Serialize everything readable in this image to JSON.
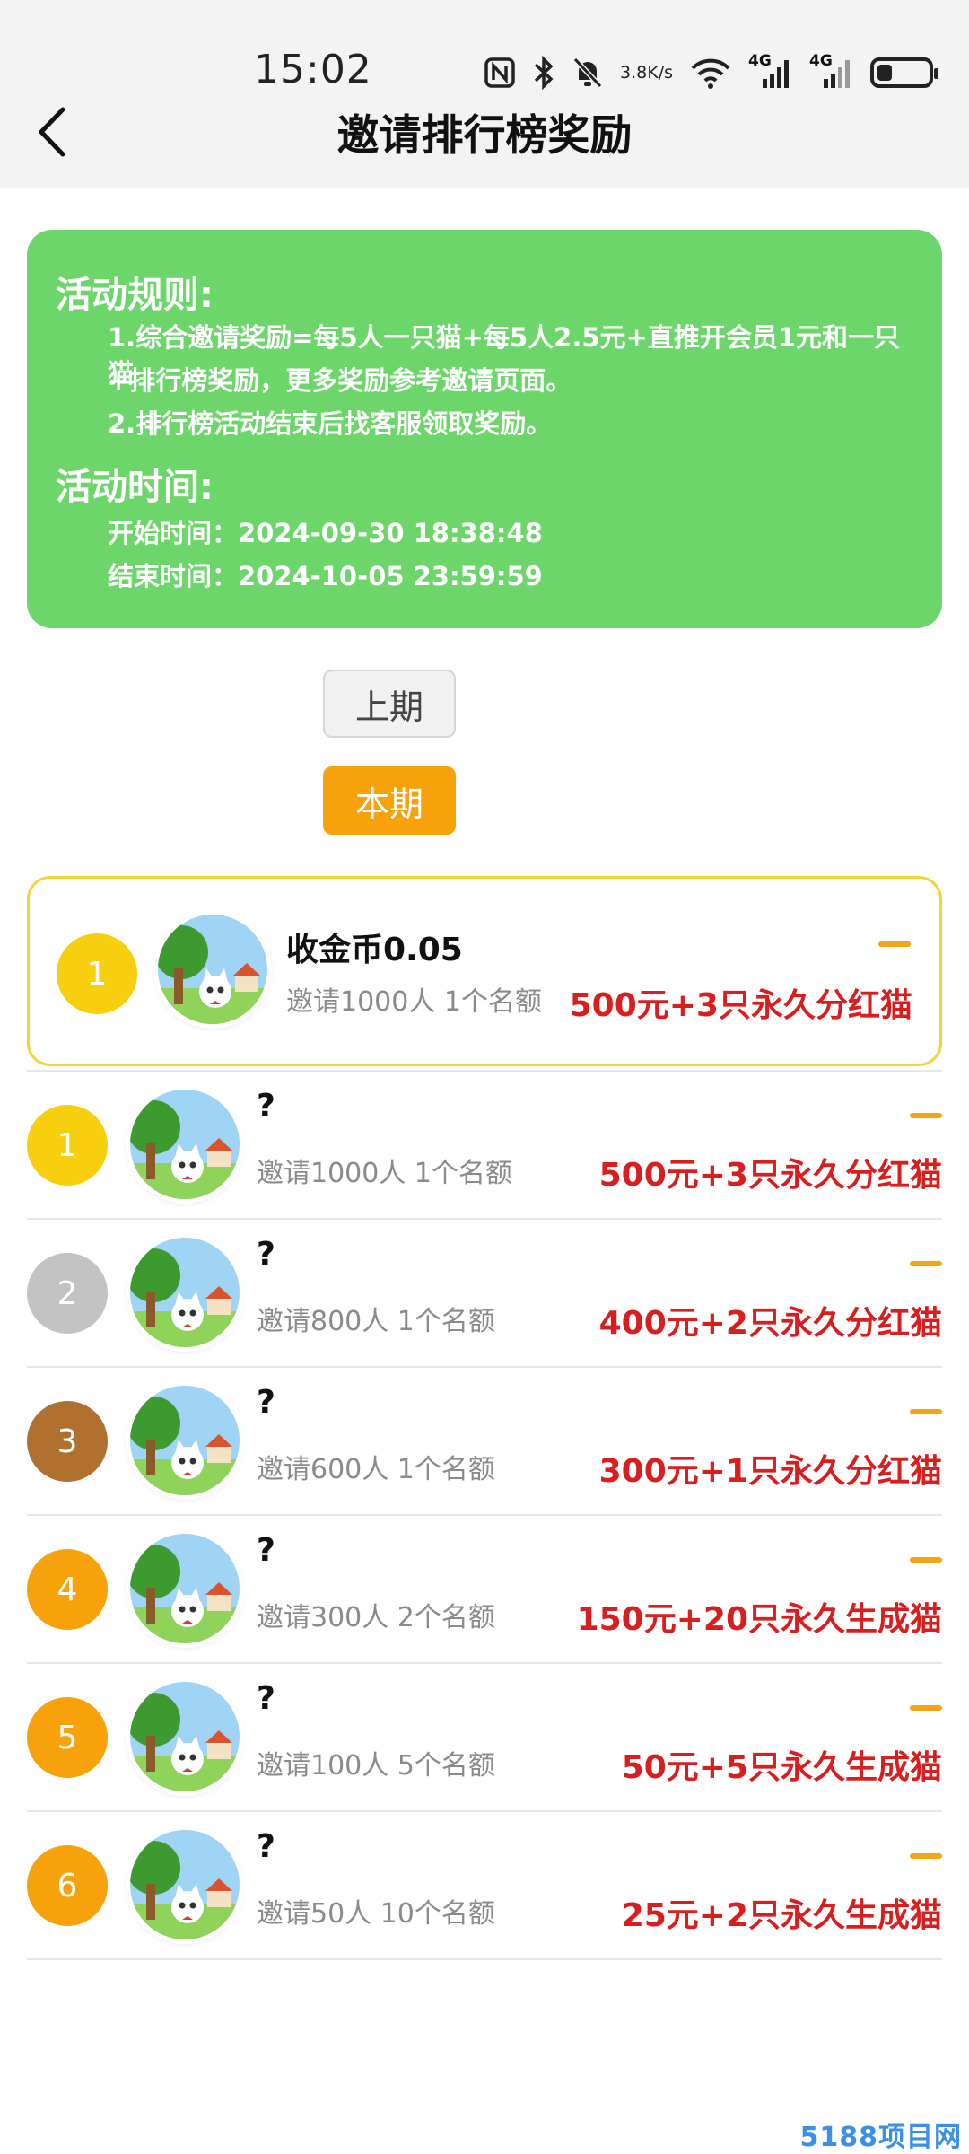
{
  "status_bar": {
    "time": "15:02",
    "speed_value": "3.8",
    "speed_unit": "K/s",
    "network_1": "4G",
    "network_2": "4G",
    "icons": [
      "nfc-icon",
      "bluetooth-icon",
      "bell-off-icon",
      "wifi-icon",
      "signal-icon",
      "signal-icon",
      "battery-icon"
    ],
    "battery_level": 0.3
  },
  "header": {
    "title": "邀请排行榜奖励",
    "back_icon": "chevron-left-icon"
  },
  "rules": {
    "rules_title": "活动规则:",
    "rule_1a": "1.综合邀请奖励=每5人一只猫+每5人2.5元+直推开会员1元和一只猫",
    "rule_1b": "+排行榜奖励，更多奖励参考邀请页面。",
    "rule_2": "2.排行榜活动结束后找客服领取奖励。",
    "time_title": "活动时间:",
    "start": "开始时间：2024-09-30 18:38:48",
    "end": "结束时间：2024-10-05 23:59:59"
  },
  "periods": {
    "previous": "上期",
    "current": "本期"
  },
  "my_entry": {
    "rank": "1",
    "name": "收金币0.05",
    "condition": "邀请1000人 1个名额",
    "reward": "500元+3只永久分红猫"
  },
  "ranking": [
    {
      "rank": "1",
      "name": "?",
      "condition": "邀请1000人 1个名额",
      "reward": "500元+3只永久分红猫",
      "color": "#f7cf0e"
    },
    {
      "rank": "2",
      "name": "?",
      "condition": "邀请800人 1个名额",
      "reward": "400元+2只永久分红猫",
      "color": "#c3c3c3"
    },
    {
      "rank": "3",
      "name": "?",
      "condition": "邀请600人 1个名额",
      "reward": "300元+1只永久分红猫",
      "color": "#b0702f"
    },
    {
      "rank": "4",
      "name": "?",
      "condition": "邀请300人 2个名额",
      "reward": "150元+20只永久生成猫",
      "color": "#f7a10b"
    },
    {
      "rank": "5",
      "name": "?",
      "condition": "邀请100人 5个名额",
      "reward": "50元+5只永久生成猫",
      "color": "#f7a10b"
    },
    {
      "rank": "6",
      "name": "?",
      "condition": "邀请50人 10个名额",
      "reward": "25元+2只永久生成猫",
      "color": "#f7a10b"
    }
  ],
  "colors": {
    "accent_orange": "#f7a10b",
    "rules_green": "#6cd66a",
    "reward_red": "#d81e1e"
  },
  "watermark": "5188项目网"
}
